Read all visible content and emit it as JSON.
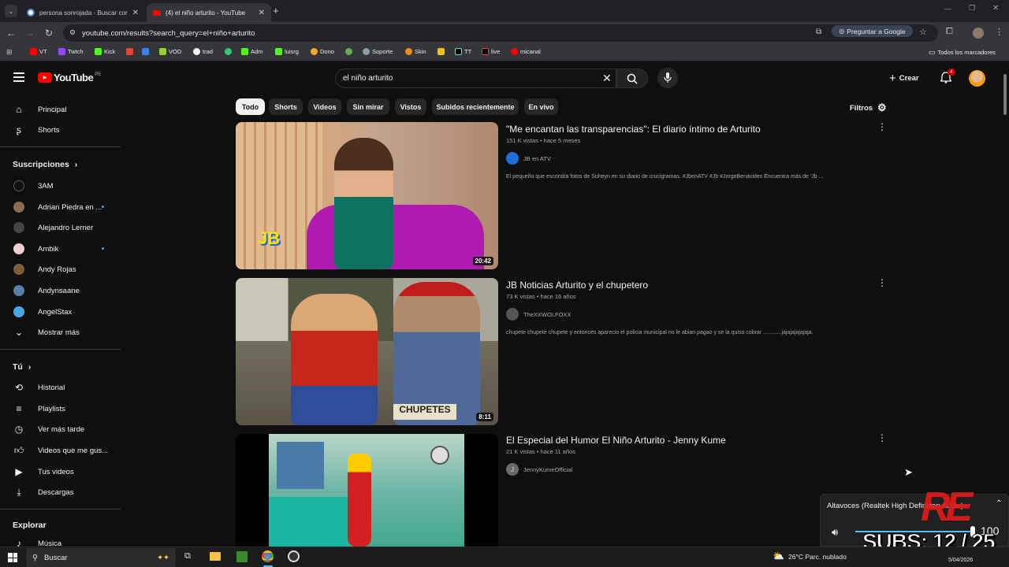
{
  "browser": {
    "tabs": [
      {
        "title": "persona sonrojada - Buscar con",
        "active": false
      },
      {
        "title": "(4) el niño arturito - YouTube",
        "active": true
      }
    ],
    "url": "youtube.com/results?search_query=el+niño+arturito",
    "ask_google": "Preguntar a Google",
    "bookmarks": [
      "VT",
      "Twtch",
      "Kick",
      "",
      "VOD",
      "trad",
      "",
      "Adm",
      "luisrg",
      "Dono",
      "",
      "Soporte",
      "Skin",
      "",
      "TT",
      "live",
      "micanal"
    ],
    "all_bookmarks": "Todos los marcadores"
  },
  "youtube": {
    "logo": "YouTube",
    "country": "PE",
    "search_value": "el niño arturito",
    "create_label": "Crear",
    "notif_count": "4",
    "chips": [
      "Todo",
      "Shorts",
      "Videos",
      "Sin mirar",
      "Vistos",
      "Subidos recientemente",
      "En vivo"
    ],
    "filters_label": "Filtros",
    "sidebar": {
      "main": [
        {
          "label": "Principal",
          "icon": "home-icon"
        },
        {
          "label": "Shorts",
          "icon": "shorts-icon"
        }
      ],
      "subs_title": "Suscripciones",
      "subs": [
        {
          "label": "3AM",
          "color": "#111",
          "dot": false
        },
        {
          "label": "Adrian Piedra en ...",
          "color": "#8b6d55",
          "dot": true
        },
        {
          "label": "Alejandro Lerner",
          "color": "#444",
          "dot": false
        },
        {
          "label": "Ambik",
          "color": "#f2cfcf",
          "dot": true
        },
        {
          "label": "Andy Rojas",
          "color": "#7b5d3c",
          "dot": false
        },
        {
          "label": "Andynsaane",
          "color": "#5a7ea8",
          "dot": false
        },
        {
          "label": "AngelStax",
          "color": "#4aa6e0",
          "dot": false
        }
      ],
      "show_more": "Mostrar más",
      "you_title": "Tú",
      "you": [
        {
          "label": "Historial",
          "icon": "history-icon"
        },
        {
          "label": "Playlists",
          "icon": "playlists-icon"
        },
        {
          "label": "Ver más tarde",
          "icon": "watch-later-icon"
        },
        {
          "label": "Videos que me gus...",
          "icon": "like-icon"
        },
        {
          "label": "Tus videos",
          "icon": "your-videos-icon"
        },
        {
          "label": "Descargas",
          "icon": "downloads-icon"
        }
      ],
      "explore_title": "Explorar",
      "explore": [
        {
          "label": "Música",
          "icon": "music-icon"
        }
      ]
    },
    "videos": [
      {
        "title": "\"Me encantan las transparencias\": El diario íntimo de Arturito",
        "meta": "151 K vistas • hace 5 meses",
        "channel": "JB en ATV",
        "desc": "El pequeño que escondía fotos de Suheyn en su diario de crucigramas. #JbenATV #Jb #JorgeBenavides Encuentra más de 'Jb ...",
        "duration": "20:42"
      },
      {
        "title": "JB Noticias Arturito y el chupetero",
        "meta": "73 K vistas • hace 16 años",
        "channel": "TheXXWOLFOXX",
        "desc": "chupete chupete chupete y entonces aparecio el policia municipal no le abian pagao y se la quiso cobrar ............jajajajajajaja.",
        "duration": "8:11"
      },
      {
        "title": "El Especial del Humor El Niño Arturito - Jenny Kume",
        "meta": "21 K vistas • hace 11 años",
        "channel": "JennyKumeOfficial",
        "desc": "",
        "duration": ""
      }
    ]
  },
  "volume_flyout": {
    "device": "Altavoces (Realtek High Definition Audio)",
    "level": "100",
    "level_fraction": 1.0
  },
  "overlay": {
    "subs_text": "SUBS: 12 / 25"
  },
  "taskbar": {
    "search": "Buscar",
    "weather": "26°C  Parc. nublado",
    "date": "5/04/2026"
  }
}
